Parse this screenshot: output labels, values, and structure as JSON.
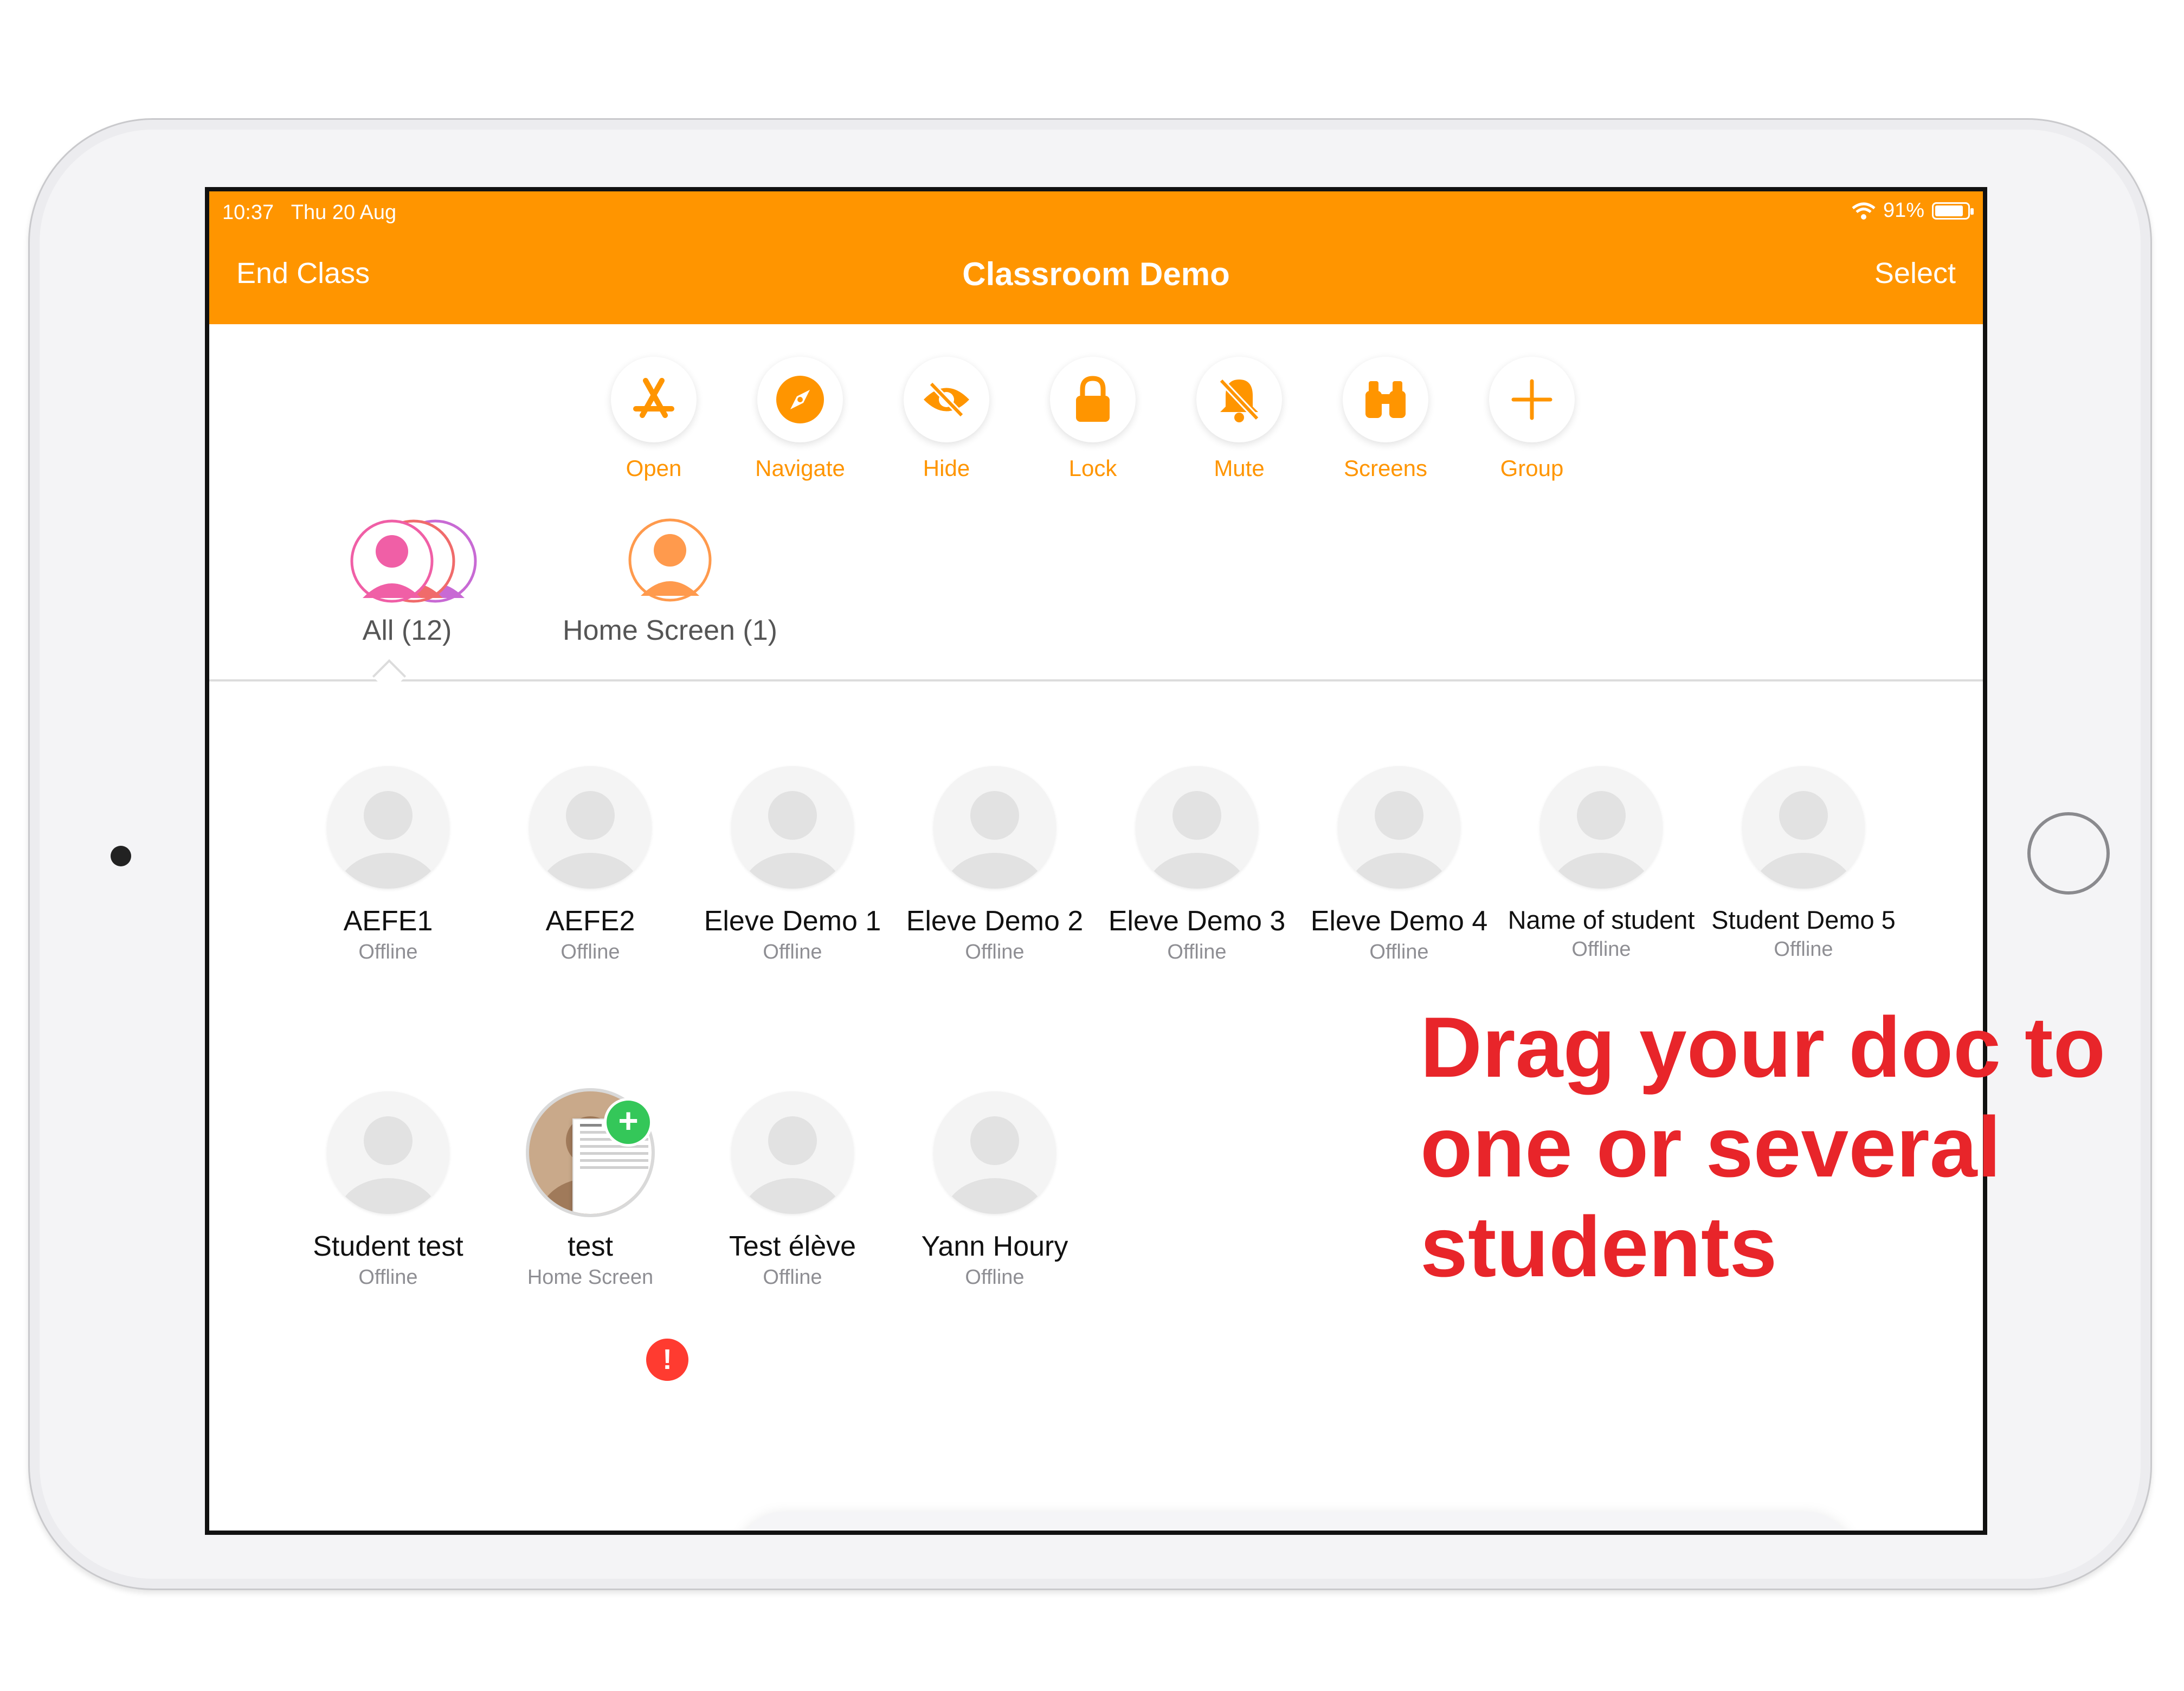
{
  "status_bar": {
    "time": "10:37",
    "date": "Thu 20 Aug",
    "battery": "91%"
  },
  "nav": {
    "left_button": "End Class",
    "title": "Classroom Demo",
    "right_button": "Select"
  },
  "toolbar": [
    {
      "label": "Open",
      "icon": "app-store-icon"
    },
    {
      "label": "Navigate",
      "icon": "compass-icon"
    },
    {
      "label": "Hide",
      "icon": "eye-slash-icon"
    },
    {
      "label": "Lock",
      "icon": "lock-icon"
    },
    {
      "label": "Mute",
      "icon": "bell-slash-icon"
    },
    {
      "label": "Screens",
      "icon": "binoculars-icon"
    },
    {
      "label": "Group",
      "icon": "plus-icon"
    }
  ],
  "groups": [
    {
      "label": "All (12)",
      "selected": true
    },
    {
      "label": "Home Screen (1)",
      "selected": false
    }
  ],
  "students": [
    {
      "name": "AEFE1",
      "status": "Offline"
    },
    {
      "name": "AEFE2",
      "status": "Offline"
    },
    {
      "name": "Eleve Demo 1",
      "status": "Offline"
    },
    {
      "name": "Eleve Demo 2",
      "status": "Offline"
    },
    {
      "name": "Eleve Demo 3",
      "status": "Offline"
    },
    {
      "name": "Eleve Demo 4",
      "status": "Offline"
    },
    {
      "name": "Name of student",
      "status": "Offline"
    },
    {
      "name": "Student Demo 5",
      "status": "Offline"
    },
    {
      "name": "Student test",
      "status": "Offline"
    },
    {
      "name": "test",
      "status": "Home Screen"
    },
    {
      "name": "Test élève",
      "status": "Offline"
    },
    {
      "name": "Yann Houry",
      "status": "Offline"
    }
  ],
  "overlay": {
    "lines": [
      "Drag your doc to",
      "one or several",
      "students"
    ],
    "color": "#e8252a"
  },
  "dock": {
    "apps": [
      "messages-icon",
      "safari-icon",
      "music-icon",
      "mail-icon",
      "files-icon",
      "classroom-icon",
      "photos-icon",
      "zoom-icon"
    ],
    "messages_badge": "!"
  },
  "colors": {
    "accent": "#ff9500",
    "add_badge": "#34c759",
    "alert_badge": "#ff3b30"
  }
}
